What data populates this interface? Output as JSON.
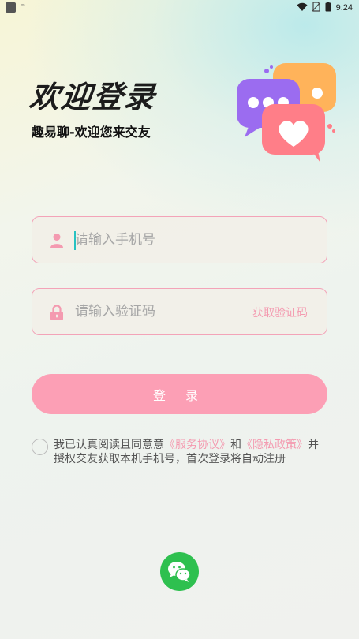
{
  "status_bar": {
    "keyboard_indicator": "⌨",
    "time": "9:24",
    "icons": [
      "app-icon",
      "wifi-icon",
      "no-sim-icon",
      "battery-icon"
    ]
  },
  "header": {
    "title": "欢迎登录",
    "subtitle": "趣易聊-欢迎您来交友",
    "illustration": "chat-bubbles-heart-illustration"
  },
  "form": {
    "phone": {
      "placeholder": "请输入手机号",
      "value": "",
      "icon": "user-icon"
    },
    "code": {
      "placeholder": "请输入验证码",
      "value": "",
      "icon": "lock-icon",
      "get_code_label": "获取验证码"
    },
    "login_label": "登 录"
  },
  "agreement": {
    "checked": false,
    "prefix": "我已认真阅读且同意意",
    "service_link": "《服务协议》",
    "conjunction": "和",
    "privacy_link": "《隐私政策》",
    "suffix": "并授权交友获取本机手机号，首次登录将自动注册"
  },
  "third_party": {
    "wechat_icon": "wechat-icon"
  },
  "colors": {
    "accent": "#fc9fb5",
    "link": "#f49ab0",
    "border": "#f3a3b8",
    "wechat": "#2ec04f",
    "caret": "#27c2c2"
  }
}
